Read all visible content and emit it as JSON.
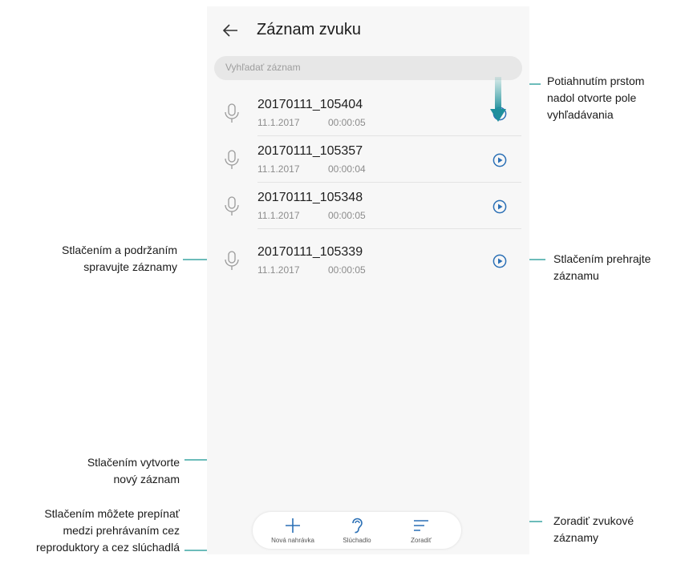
{
  "app": {
    "title": "Záznam zvuku",
    "search_placeholder": "Vyhľadať záznam",
    "accent_color": "#2a6fb5",
    "icons": [
      "back-arrow-icon",
      "microphone-icon",
      "play-icon",
      "plus-icon",
      "ear-icon",
      "sort-icon",
      "swipe-down-arrow-icon"
    ]
  },
  "recordings": [
    {
      "name": "20170111_105404",
      "date": "11.1.2017",
      "duration": "00:00:05"
    },
    {
      "name": "20170111_105357",
      "date": "11.1.2017",
      "duration": "00:00:04"
    },
    {
      "name": "20170111_105348",
      "date": "11.1.2017",
      "duration": "00:00:05"
    },
    {
      "name": "20170111_105339",
      "date": "11.1.2017",
      "duration": "00:00:05"
    }
  ],
  "bottom_bar": {
    "new_label": "Nová nahrávka",
    "earpiece_label": "Slúchadlo",
    "sort_label": "Zoradiť"
  },
  "callouts": {
    "swipe": [
      "Potiahnutím prstom",
      "nadol otvorte pole",
      "vyhľadávania"
    ],
    "manage": [
      "Stlačením a podržaním",
      "spravujte záznamy"
    ],
    "play": [
      "Stlačením prehrajte",
      "záznamu"
    ],
    "create": [
      "Stlačením vytvorte",
      "nový záznam"
    ],
    "toggle": [
      "Stlačením môžete prepínať",
      "medzi prehrávaním cez",
      "reproduktory a cez slúchadlá"
    ],
    "sort": [
      "Zoradiť zvukové",
      "záznamy"
    ]
  }
}
